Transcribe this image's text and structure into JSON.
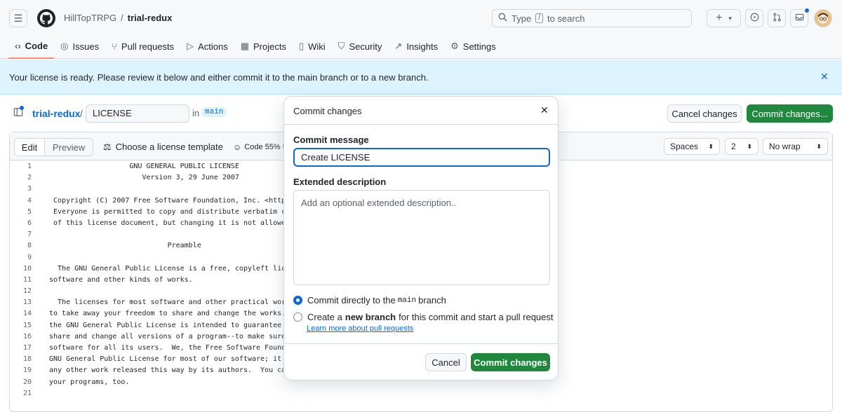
{
  "header": {
    "owner": "HillTopTRPG",
    "separator": "/",
    "repo": "trial-redux",
    "search_text_before": "Type",
    "search_key": "/",
    "search_text_after": "to search",
    "plus": "+",
    "caret": "▾"
  },
  "nav": {
    "tabs": [
      {
        "label": "Code",
        "icon": "code-icon"
      },
      {
        "label": "Issues",
        "icon": "issue-icon"
      },
      {
        "label": "Pull requests",
        "icon": "pull-request-icon"
      },
      {
        "label": "Actions",
        "icon": "play-icon"
      },
      {
        "label": "Projects",
        "icon": "table-icon"
      },
      {
        "label": "Wiki",
        "icon": "book-icon"
      },
      {
        "label": "Security",
        "icon": "shield-icon"
      },
      {
        "label": "Insights",
        "icon": "graph-icon"
      },
      {
        "label": "Settings",
        "icon": "gear-icon"
      }
    ]
  },
  "flash": {
    "message": "Your license is ready. Please review it below and either commit it to the main branch or to a new branch."
  },
  "file": {
    "repo": "trial-redux",
    "sep": "/",
    "filename": "LICENSE",
    "in": "in",
    "branch": "main",
    "cancel_label": "Cancel changes",
    "commit_label": "Commit changes..."
  },
  "editor": {
    "edit_tab": "Edit",
    "preview_tab": "Preview",
    "choose_template": "Choose a license template",
    "code_pct": "Code 55% f",
    "indent_mode": "Spaces",
    "indent_size": "2",
    "wrap_mode": "No wrap",
    "lines": [
      {
        "n": "1",
        "t": "                   GNU GENERAL PUBLIC LICENSE"
      },
      {
        "n": "2",
        "t": "                      Version 3, 29 June 2007"
      },
      {
        "n": "3",
        "t": ""
      },
      {
        "n": "4",
        "t": " Copyright (C) 2007 Free Software Foundation, Inc. <https"
      },
      {
        "n": "5",
        "t": " Everyone is permitted to copy and distribute verbatim co"
      },
      {
        "n": "6",
        "t": " of this license document, but changing it is not allowed"
      },
      {
        "n": "7",
        "t": ""
      },
      {
        "n": "8",
        "t": "                            Preamble"
      },
      {
        "n": "9",
        "t": ""
      },
      {
        "n": "10",
        "t": "  The GNU General Public License is a free, copyleft lice"
      },
      {
        "n": "11",
        "t": "software and other kinds of works."
      },
      {
        "n": "12",
        "t": ""
      },
      {
        "n": "13",
        "t": "  The licenses for most software and other practical work"
      },
      {
        "n": "14",
        "t": "to take away your freedom to share and change the works."
      },
      {
        "n": "15",
        "t": "the GNU General Public License is intended to guarantee y"
      },
      {
        "n": "16",
        "t": "share and change all versions of a program--to make sure"
      },
      {
        "n": "17",
        "t": "software for all its users.  We, the Free Software Founda"
      },
      {
        "n": "18",
        "t": "GNU General Public License for most of our software; it a"
      },
      {
        "n": "19",
        "t": "any other work released this way by its authors.  You can"
      },
      {
        "n": "20",
        "t": "your programs, too."
      },
      {
        "n": "21",
        "t": ""
      }
    ]
  },
  "dialog": {
    "title": "Commit changes",
    "message_label": "Commit message",
    "message_value": "Create LICENSE",
    "description_label": "Extended description",
    "description_placeholder": "Add an optional extended description..",
    "option_direct_pre": "Commit directly to the",
    "option_direct_branch": "main",
    "option_direct_post": "branch",
    "option_new_pre": "Create a",
    "option_new_bold": "new branch",
    "option_new_post": "for this commit and start a pull request",
    "learn_more": "Learn more about pull requests",
    "cancel_label": "Cancel",
    "commit_label": "Commit changes"
  }
}
